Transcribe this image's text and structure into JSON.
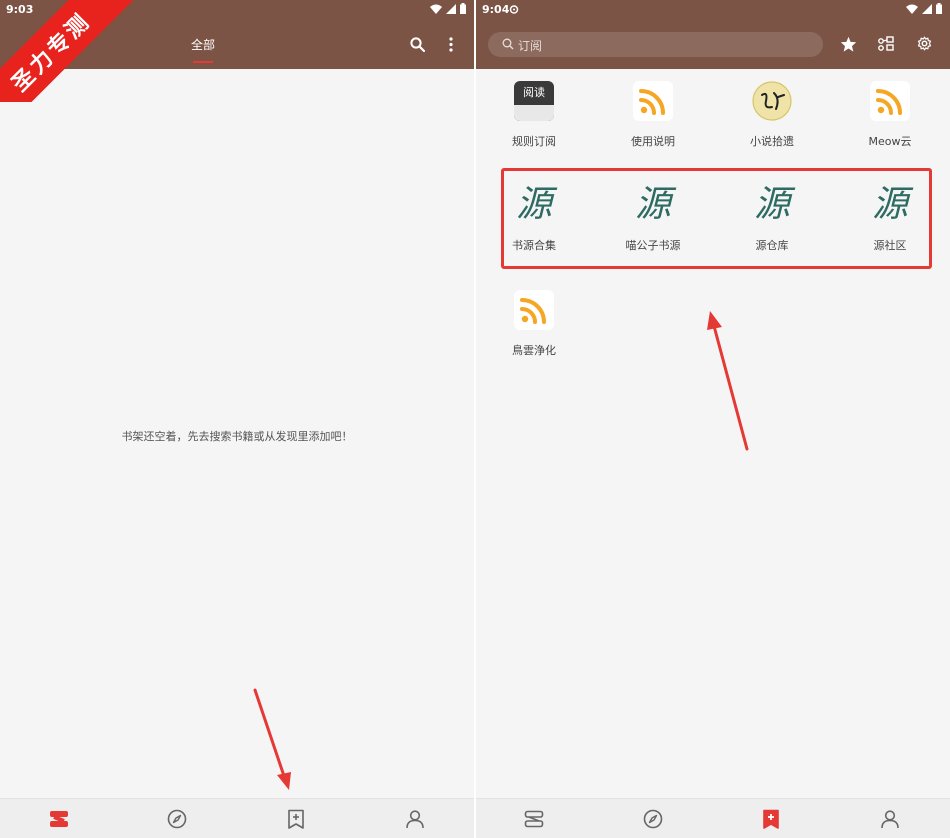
{
  "left": {
    "status_time": "9:03",
    "tab_label": "全部",
    "empty_message": "书架还空着，先去搜索书籍或从发现里添加吧！",
    "bottom_nav": [
      {
        "name": "bookshelf",
        "icon": "bookshelf-icon",
        "active": true
      },
      {
        "name": "discover",
        "icon": "compass-icon",
        "active": false
      },
      {
        "name": "subscribe",
        "icon": "bookmark-plus-icon",
        "active": false
      },
      {
        "name": "profile",
        "icon": "person-icon",
        "active": false
      }
    ]
  },
  "right": {
    "status_time": "9:04",
    "search_placeholder": "订阅",
    "subscriptions_row1": [
      {
        "label": "规则订阅",
        "icon": "read-app-icon"
      },
      {
        "label": "使用说明",
        "icon": "rss-icon"
      },
      {
        "label": "小说拾遗",
        "icon": "novel-seal-icon"
      },
      {
        "label": "Meow云",
        "icon": "rss-icon"
      }
    ],
    "subscriptions_row2": [
      {
        "label": "书源合集",
        "glyph": "源"
      },
      {
        "label": "喵公子书源",
        "glyph": "源"
      },
      {
        "label": "源仓库",
        "glyph": "源"
      },
      {
        "label": "源社区",
        "glyph": "源"
      }
    ],
    "subscriptions_row3": [
      {
        "label": "鳥雲浄化",
        "icon": "rss-icon"
      }
    ],
    "read_icon_text": "阅读",
    "bottom_nav": [
      {
        "name": "bookshelf",
        "icon": "bookshelf-icon",
        "active": false
      },
      {
        "name": "discover",
        "icon": "compass-icon",
        "active": false
      },
      {
        "name": "subscribe",
        "icon": "bookmark-plus-icon",
        "active": true
      },
      {
        "name": "profile",
        "icon": "person-icon",
        "active": false
      }
    ]
  },
  "watermark": "圣力专测",
  "colors": {
    "toolbar": "#7b5446",
    "accent": "#e53935",
    "rss_orange": "#f5a623",
    "yuan_green": "#2d6b63",
    "background": "#f5f5f5"
  }
}
